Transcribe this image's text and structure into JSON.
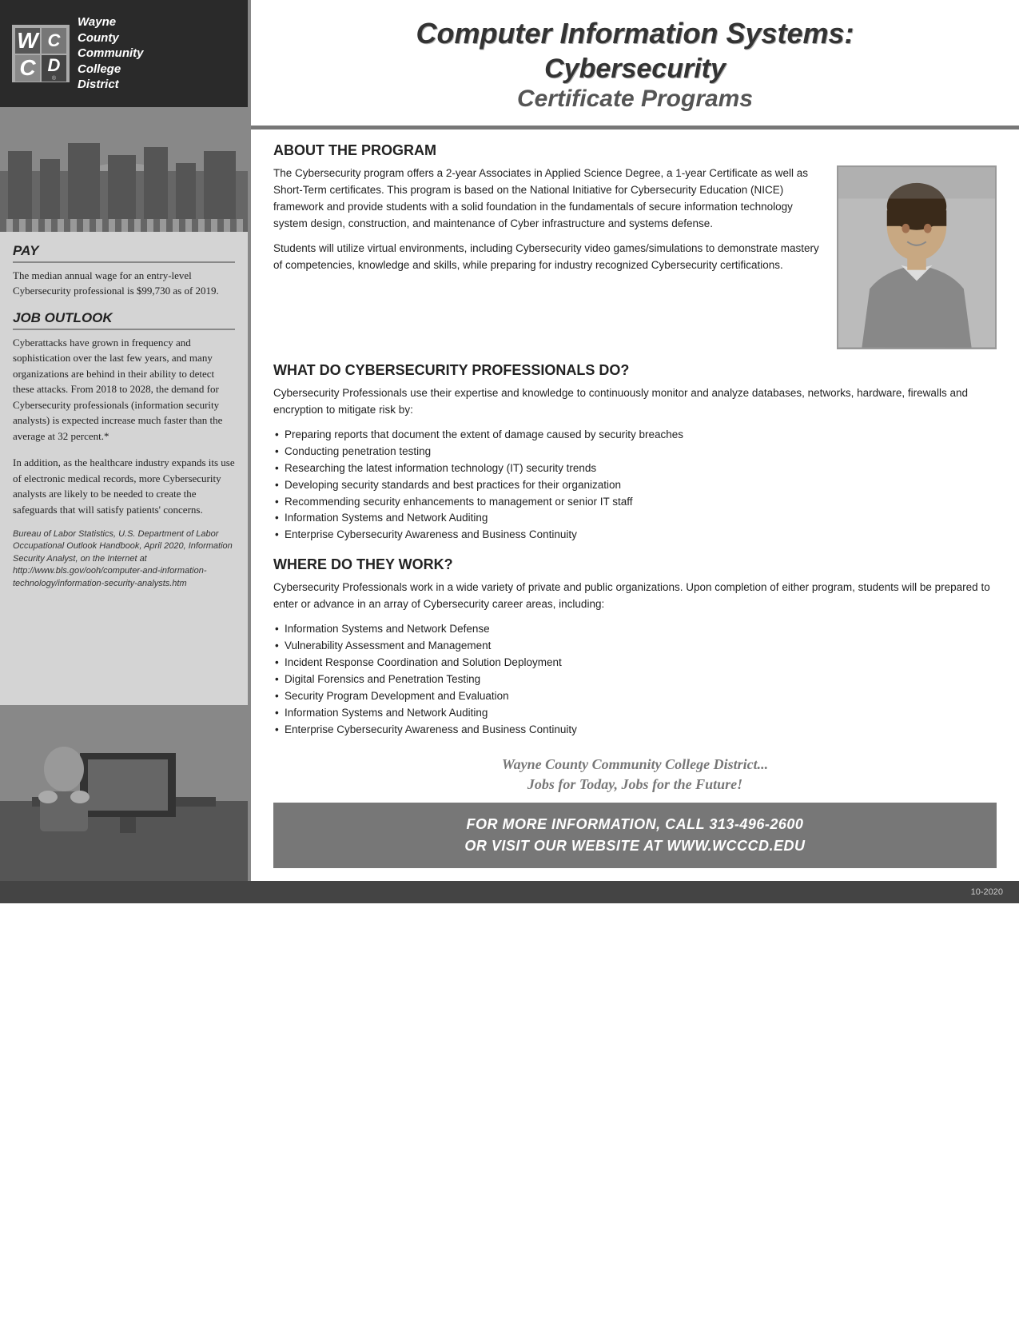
{
  "header": {
    "title": "Computer Information Systems:\nCybersecurity",
    "subtitle": "Certificate Programs",
    "logo": {
      "letters": [
        "W",
        "C",
        "C",
        "D"
      ],
      "org_name_lines": [
        "Wayne",
        "County",
        "Community",
        "College",
        "District"
      ]
    }
  },
  "sidebar": {
    "pay_title": "PAY",
    "pay_text": "The median annual wage for an entry-level Cybersecurity professional is $99,730 as of 2019.",
    "job_outlook_title": "JOB OUTLOOK",
    "job_outlook_text1": "Cyberattacks have grown in frequency and sophistication over the last few years, and many organizations are behind in their ability to detect these attacks. From 2018 to 2028, the demand for Cybersecurity professionals (information security analysts) is expected increase much faster than the average at 32 percent.*",
    "job_outlook_text2": "In addition, as the healthcare industry expands its use of electronic medical records, more Cybersecurity analysts are likely to be needed to create the safeguards that will satisfy patients' concerns.",
    "citation": "Bureau of Labor Statistics, U.S. Department of Labor Occupational Outlook Handbook, April 2020, Information Security Analyst, on the Internet at http://www.bls.gov/ooh/computer-and-information-technology/information-security-analysts.htm"
  },
  "about": {
    "section_title": "ABOUT THE PROGRAM",
    "text1": "The Cybersecurity program offers a 2-year Associates in Applied Science Degree, a 1-year Certificate as well as Short-Term certificates. This program is based on the National Initiative for Cybersecurity Education (NICE) framework and provide students with a solid foundation in the fundamentals of secure information technology system design, construction, and maintenance of Cyber infrastructure and systems defense.",
    "text2": "Students will utilize virtual environments, including Cybersecurity video games/simulations to demonstrate mastery of competencies, knowledge and skills, while preparing for industry recognized Cybersecurity certifications."
  },
  "what_do": {
    "section_title": "WHAT DO CYBERSECURITY PROFESSIONALS DO?",
    "intro": "Cybersecurity Professionals use their expertise and knowledge to continuously monitor and analyze databases, networks, hardware, firewalls and encryption to mitigate risk by:",
    "bullets": [
      "Preparing reports that document the extent of damage caused by security breaches",
      "Conducting penetration testing",
      "Researching the latest information technology (IT) security trends",
      "Developing security standards and best practices for their organization",
      "Recommending security enhancements to management or senior IT staff",
      "Information Systems and Network Auditing",
      "Enterprise Cybersecurity Awareness and Business Continuity"
    ]
  },
  "where_work": {
    "section_title": "WHERE DO THEY WORK?",
    "intro": "Cybersecurity Professionals work in a wide variety of private and public organizations. Upon completion of either program, students will be prepared to enter or advance in an array of Cybersecurity career areas, including:",
    "bullets": [
      "Information Systems and Network Defense",
      "Vulnerability Assessment and Management",
      "Incident Response Coordination and Solution Deployment",
      "Digital Forensics and Penetration Testing",
      "Security Program Development and Evaluation",
      "Information Systems and Network Auditing",
      "Enterprise Cybersecurity Awareness and Business Continuity"
    ]
  },
  "footer": {
    "tagline_line1": "Wayne County Community College District...",
    "tagline_line2": "Jobs for Today, Jobs for the Future!",
    "contact_line1": "FOR MORE INFORMATION, CALL 313-496-2600",
    "contact_line2": "OR VISIT OUR WEBSITE AT WWW.WCCCD.EDU",
    "date": "10-2020"
  }
}
